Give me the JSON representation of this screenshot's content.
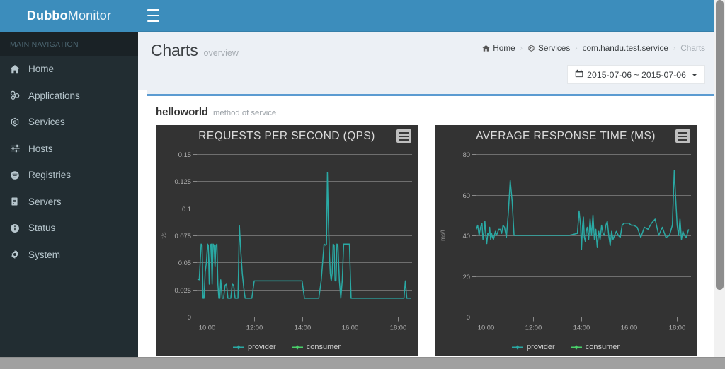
{
  "brand": {
    "bold": "Dubbo",
    "light": "Monitor"
  },
  "topbar": {
    "toggle_icon": "hamburger-icon"
  },
  "sidebar": {
    "nav_header": "MAIN NAVIGATION",
    "items": [
      {
        "label": "Home",
        "icon": "home-icon"
      },
      {
        "label": "Applications",
        "icon": "cubes-icon"
      },
      {
        "label": "Services",
        "icon": "gear-outline-icon"
      },
      {
        "label": "Hosts",
        "icon": "sliders-icon"
      },
      {
        "label": "Registries",
        "icon": "globe-icon"
      },
      {
        "label": "Servers",
        "icon": "server-icon"
      },
      {
        "label": "Status",
        "icon": "info-circle-icon"
      },
      {
        "label": "System",
        "icon": "cog-icon"
      }
    ]
  },
  "header": {
    "title": "Charts",
    "subtitle": "overview",
    "breadcrumb": [
      {
        "label": "Home",
        "icon": "home-icon"
      },
      {
        "label": "Services",
        "icon": "gear-outline-icon"
      },
      {
        "label": "com.handu.test.service",
        "icon": ""
      },
      {
        "label": "Charts",
        "icon": ""
      }
    ],
    "breadcrumb_separator": "›",
    "daterange": {
      "icon": "calendar-icon",
      "value": "2015-07-06 ~ 2015-07-06",
      "caret": "chevron-down-icon"
    }
  },
  "panel": {
    "method_name": "helloworld",
    "method_sub": "method of service"
  },
  "colors": {
    "brand_blue": "#3c8dbc",
    "sidebar_dark": "#222d32",
    "panel_accent": "#5b9bd1",
    "chart_bg": "#333333",
    "provider": "#2aa9a4",
    "consumer": "#4ad16a"
  },
  "chart_data": [
    {
      "type": "line",
      "title": "REQUESTS PER SECOND (QPS)",
      "menu_icon": "hamburger-menu-icon",
      "xlabel": "",
      "ylabel": "t/s",
      "ylim": [
        0,
        0.15
      ],
      "yticks": [
        0,
        0.025,
        0.05,
        0.075,
        0.1,
        0.125,
        0.15
      ],
      "ytick_labels": [
        "0",
        "0.025",
        "0.05",
        "0.075",
        "0.1",
        "0.125",
        "0.15"
      ],
      "xticks": [
        "10:00",
        "12:00",
        "14:00",
        "16:00",
        "18:00"
      ],
      "xlim_hours": [
        9.6,
        18.6
      ],
      "grid": true,
      "legend_position": "bottom",
      "legend": [
        {
          "name": "provider",
          "color": "#2aa9a4"
        },
        {
          "name": "consumer",
          "color": "#4ad16a"
        }
      ],
      "series": [
        {
          "name": "provider",
          "color": "#2aa9a4",
          "x": [
            9.62,
            9.7,
            9.78,
            9.82,
            9.86,
            9.9,
            9.95,
            10.0,
            10.05,
            10.08,
            10.12,
            10.16,
            10.2,
            10.24,
            10.28,
            10.32,
            10.36,
            10.4,
            10.44,
            10.48,
            10.52,
            10.56,
            10.6,
            10.66,
            10.72,
            10.78,
            10.84,
            10.9,
            10.96,
            11.02,
            11.08,
            11.14,
            11.2,
            11.26,
            11.32,
            11.38,
            11.44,
            11.5,
            11.56,
            11.62,
            11.7,
            11.8,
            11.9,
            12.0,
            12.4,
            12.8,
            13.2,
            13.6,
            14.0,
            14.1,
            14.2,
            14.3,
            14.4,
            14.5,
            14.6,
            14.7,
            14.8,
            14.86,
            14.92,
            14.97,
            15.02,
            15.06,
            15.1,
            15.14,
            15.18,
            15.22,
            15.26,
            15.3,
            15.34,
            15.38,
            15.42,
            15.46,
            15.5,
            15.56,
            15.62,
            15.68,
            15.74,
            15.8,
            15.86,
            15.92,
            15.98,
            16.05,
            16.2,
            16.4,
            16.8,
            17.2,
            17.6,
            18.0,
            18.2,
            18.26,
            18.32,
            18.38,
            18.45,
            18.55
          ],
          "y": [
            0.035,
            0.034,
            0.067,
            0.066,
            0.017,
            0.017,
            0.041,
            0.05,
            0.067,
            0.066,
            0.03,
            0.066,
            0.067,
            0.03,
            0.067,
            0.066,
            0.046,
            0.066,
            0.067,
            0.03,
            0.017,
            0.017,
            0.034,
            0.017,
            0.017,
            0.029,
            0.03,
            0.017,
            0.017,
            0.017,
            0.03,
            0.029,
            0.017,
            0.017,
            0.017,
            0.084,
            0.06,
            0.04,
            0.027,
            0.017,
            0.017,
            0.017,
            0.017,
            0.033,
            0.033,
            0.033,
            0.033,
            0.033,
            0.033,
            0.017,
            0.017,
            0.017,
            0.017,
            0.017,
            0.017,
            0.017,
            0.033,
            0.05,
            0.067,
            0.066,
            0.067,
            0.133,
            0.09,
            0.06,
            0.04,
            0.033,
            0.04,
            0.067,
            0.066,
            0.033,
            0.033,
            0.067,
            0.066,
            0.033,
            0.017,
            0.033,
            0.067,
            0.067,
            0.067,
            0.067,
            0.067,
            0.017,
            0.017,
            0.017,
            0.017,
            0.017,
            0.017,
            0.017,
            0.017,
            0.017,
            0.033,
            0.017,
            0.017,
            0.017
          ]
        }
      ]
    },
    {
      "type": "line",
      "title": "AVERAGE RESPONSE TIME (MS)",
      "menu_icon": "hamburger-menu-icon",
      "xlabel": "",
      "ylabel": "ms/t",
      "ylim": [
        0,
        80
      ],
      "yticks": [
        0,
        20,
        40,
        60,
        80
      ],
      "ytick_labels": [
        "0",
        "20",
        "40",
        "60",
        "80"
      ],
      "xticks": [
        "10:00",
        "12:00",
        "14:00",
        "16:00",
        "18:00"
      ],
      "xlim_hours": [
        9.6,
        18.6
      ],
      "grid": true,
      "legend_position": "bottom",
      "legend": [
        {
          "name": "provider",
          "color": "#2aa9a4"
        },
        {
          "name": "consumer",
          "color": "#4ad16a"
        }
      ],
      "series": [
        {
          "name": "provider",
          "color": "#2aa9a4",
          "x": [
            9.62,
            9.68,
            9.74,
            9.8,
            9.86,
            9.9,
            9.94,
            9.98,
            10.02,
            10.06,
            10.1,
            10.14,
            10.18,
            10.22,
            10.26,
            10.3,
            10.34,
            10.38,
            10.42,
            10.46,
            10.5,
            10.56,
            10.62,
            10.68,
            10.74,
            10.8,
            10.88,
            10.96,
            11.04,
            11.12,
            11.2,
            11.28,
            11.36,
            11.42,
            11.48,
            11.54,
            11.6,
            11.66,
            11.72,
            12.0,
            12.5,
            13.0,
            13.5,
            13.85,
            13.92,
            13.98,
            14.02,
            14.06,
            14.1,
            14.14,
            14.18,
            14.22,
            14.26,
            14.32,
            14.38,
            14.44,
            14.5,
            14.56,
            14.62,
            14.68,
            14.74,
            14.8,
            14.86,
            14.92,
            14.98,
            15.04,
            15.1,
            15.16,
            15.22,
            15.28,
            15.34,
            15.4,
            15.48,
            15.56,
            15.64,
            15.72,
            15.8,
            15.9,
            16.0,
            16.1,
            16.2,
            16.35,
            16.5,
            16.65,
            16.8,
            16.95,
            17.1,
            17.25,
            17.4,
            17.55,
            17.7,
            17.82,
            17.9,
            17.96,
            18.02,
            18.08,
            18.14,
            18.2,
            18.26,
            18.32,
            18.4,
            18.5
          ],
          "y": [
            43,
            45,
            40,
            44,
            46,
            38,
            41,
            47,
            40,
            36,
            41,
            40,
            44,
            38,
            41,
            39,
            38,
            40,
            42,
            40,
            41,
            43,
            43,
            41,
            45,
            44,
            39,
            51,
            67,
            57,
            40,
            40,
            40,
            40,
            40,
            40,
            40,
            40,
            40,
            40,
            40,
            40,
            40,
            41,
            52,
            45,
            33,
            44,
            49,
            39,
            37,
            42,
            44,
            38,
            48,
            40,
            50,
            38,
            43,
            34,
            42,
            38,
            45,
            41,
            40,
            45,
            47,
            40,
            35,
            42,
            38,
            40,
            42,
            40,
            39,
            45,
            46,
            46,
            46,
            45,
            45,
            44,
            39,
            44,
            43,
            46,
            48,
            40,
            44,
            39,
            40,
            45,
            72,
            58,
            45,
            40,
            48,
            38,
            42,
            40,
            39,
            43
          ]
        }
      ]
    }
  ]
}
